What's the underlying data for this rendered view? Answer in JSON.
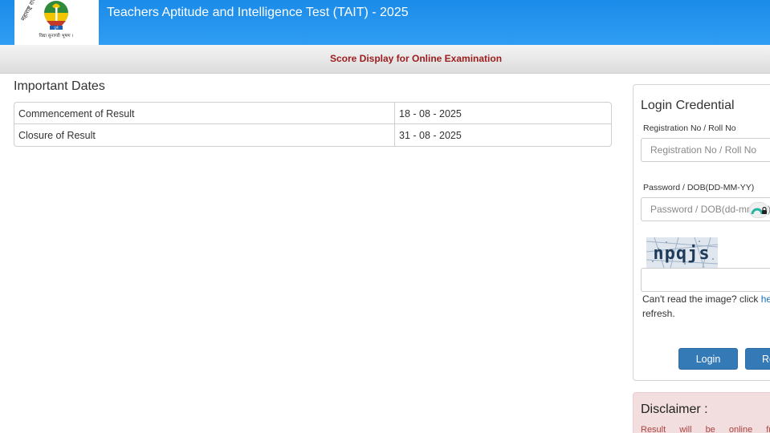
{
  "header": {
    "title": "Teachers Aptitude and Intelligence Test (TAIT) - 2025",
    "logo": {
      "top_text": "महाराष्ट्र राज्य परीक्षा परिषद",
      "bottom_text": "विद्या सुनाण्डी भूषण ।",
      "badge_text": "पुणे",
      "colors": {
        "green": "#2e8b3c",
        "yellow": "#f2c500",
        "red": "#c0392b",
        "blue": "#1a5fb4"
      }
    }
  },
  "subbar": {
    "title": "Score Display for Online Examination"
  },
  "important_dates": {
    "heading": "Important Dates",
    "rows": [
      {
        "label": "Commencement of Result",
        "value": "18 - 08 - 2025"
      },
      {
        "label": "Closure of Result",
        "value": "31 - 08 - 2025"
      }
    ]
  },
  "login": {
    "title": "Login Credential",
    "registration_label": "Registration No / Roll No",
    "registration_placeholder": "Registration No / Roll No",
    "password_label": "Password / DOB(DD-MM-YY)",
    "password_placeholder": "Password / DOB(dd-mm-yy)",
    "captcha_text": "npqjs",
    "captcha_input_value": "",
    "captcha_help_prefix": "Can't read the image? click ",
    "captcha_help_link": "here",
    "captcha_help_suffix": " to refresh.",
    "login_button": "Login",
    "reset_button": "Reset"
  },
  "disclaimer": {
    "title": "Disclaimer :",
    "text": "Result will be online from the"
  },
  "colors": {
    "header_blue": "#2196f3",
    "subbar_text": "#9b1c1c",
    "button_blue": "#337ab7",
    "disclaimer_bg": "#f2dede"
  }
}
